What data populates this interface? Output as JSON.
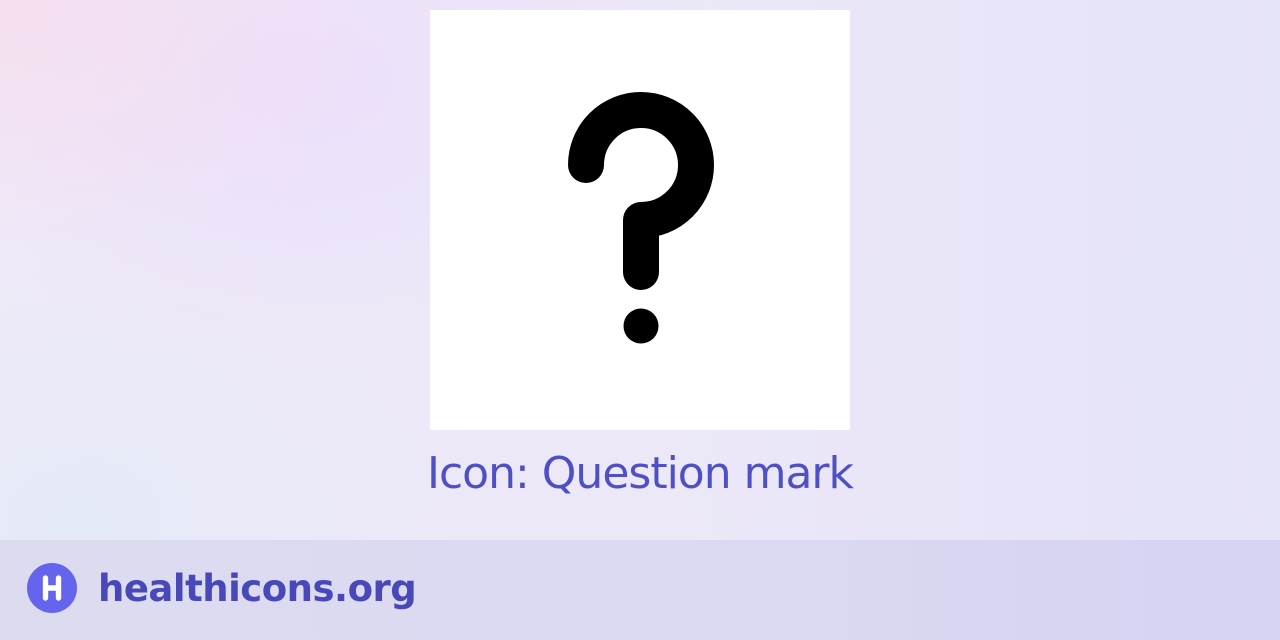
{
  "icon_card": {
    "icon": "question-mark-icon"
  },
  "caption": "Icon: Question mark",
  "footer": {
    "logo_icon": "healthicons-logo-icon",
    "site_name": "healthicons.org"
  },
  "colors": {
    "caption": "#4f4fc6",
    "logo_background": "#6464ec",
    "site_name": "#4848b8",
    "icon_card_background": "#ffffff",
    "glyph": "#000000"
  }
}
